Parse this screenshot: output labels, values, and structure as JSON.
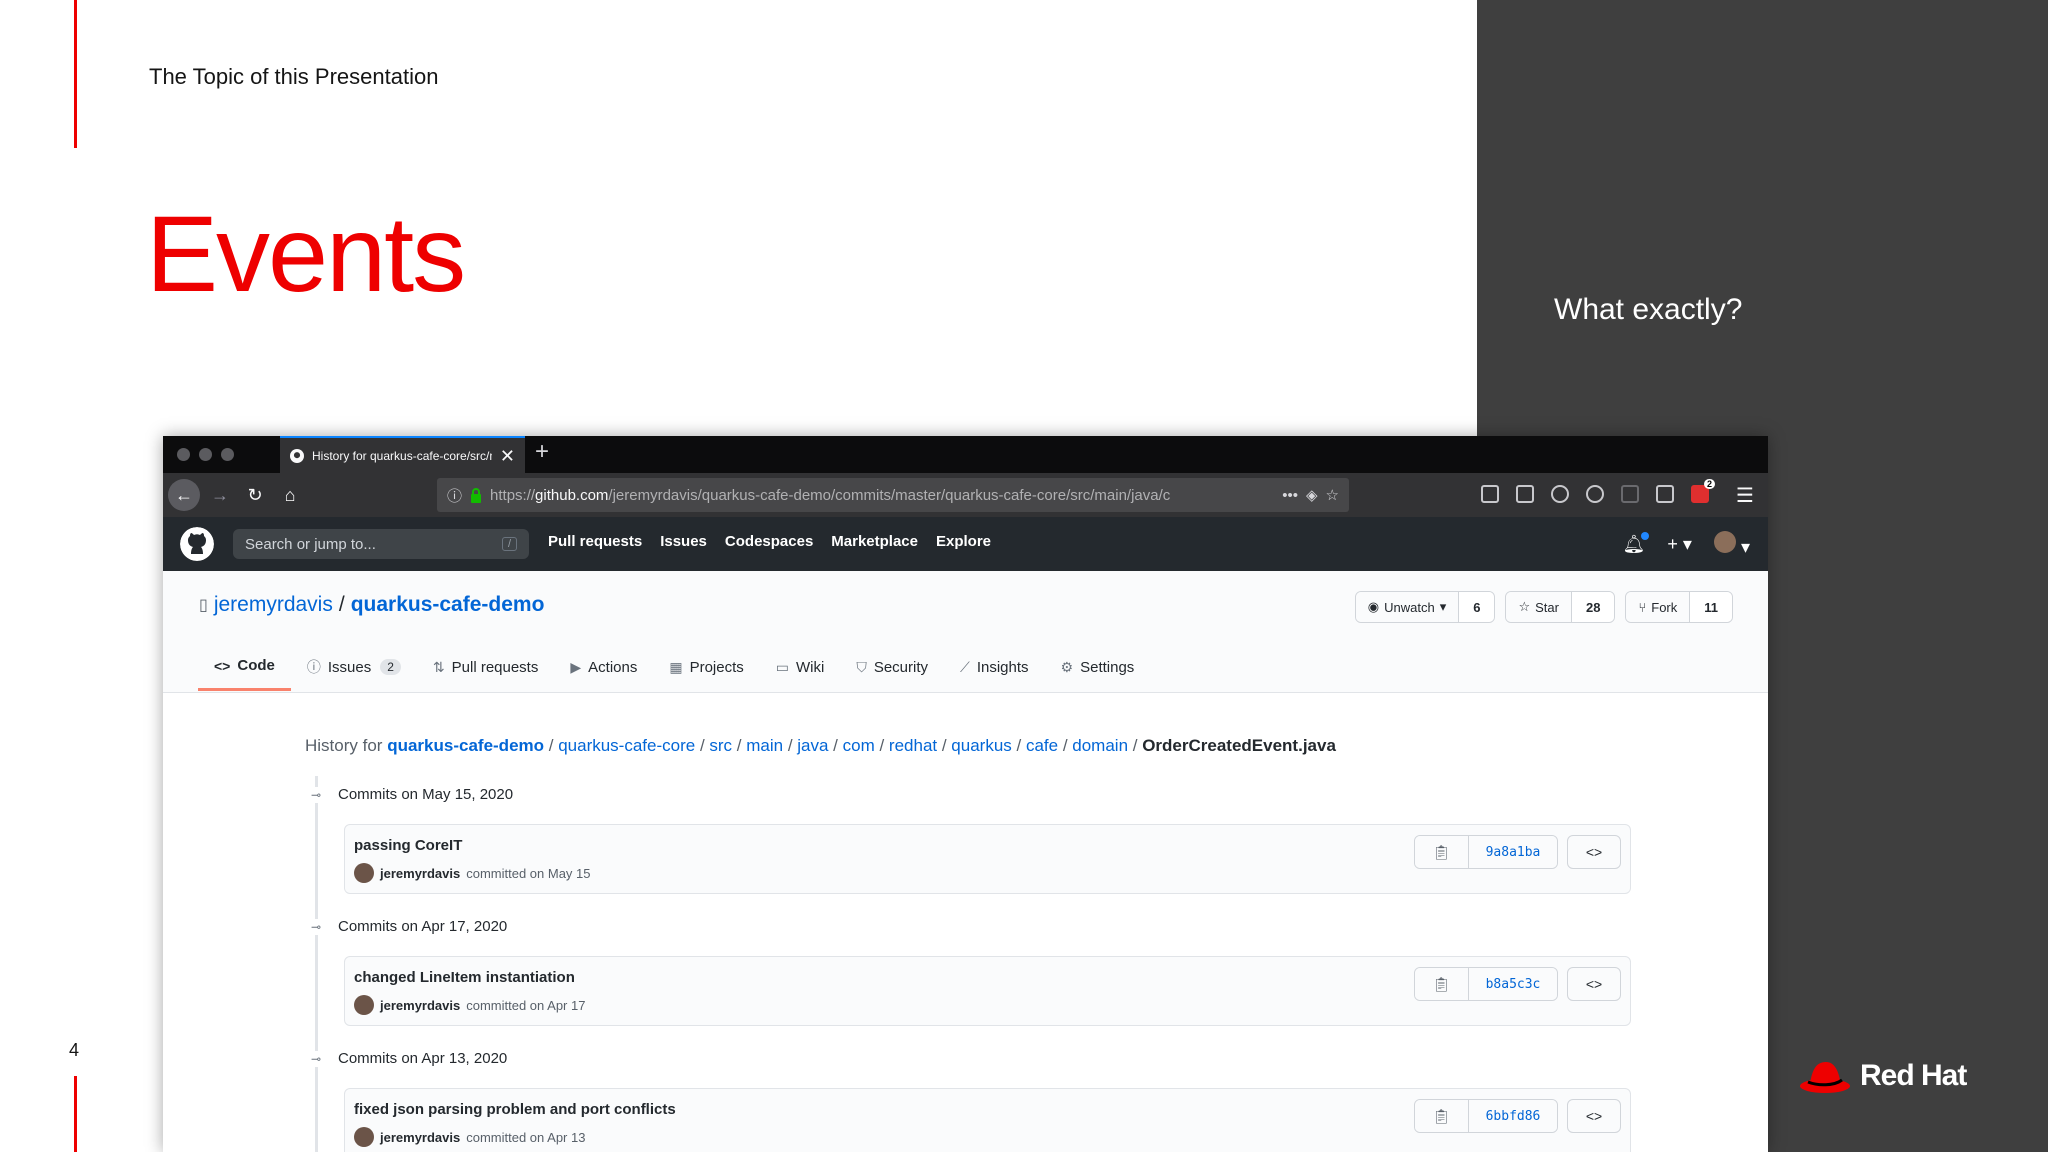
{
  "slide": {
    "topic": "The Topic of this Presentation",
    "title": "Events",
    "side_question": "What exactly?",
    "page_number": "4",
    "brand": "Red Hat",
    "accent_color": "#ee0000",
    "side_bg": "#3f3f3f"
  },
  "browser": {
    "tab_title": "History for quarkus-cafe-core/src/main/java",
    "tab_close": "✕",
    "new_tab": "+",
    "url_scheme": "https://",
    "url_host": "github.com",
    "url_path": "/jeremyrdavis/quarkus-cafe-demo/commits/master/quarkus-cafe-core/src/main/java/c",
    "url_more": "•••",
    "toolbar_badge": "2"
  },
  "github": {
    "search_placeholder": "Search or jump to...",
    "search_shortcut": "/",
    "nav": [
      "Pull requests",
      "Issues",
      "Codespaces",
      "Marketplace",
      "Explore"
    ],
    "repo_owner": "jeremyrdavis",
    "repo_sep": "/",
    "repo_name": "quarkus-cafe-demo",
    "unwatch_label": "Unwatch",
    "unwatch_count": "6",
    "star_label": "Star",
    "star_count": "28",
    "fork_label": "Fork",
    "fork_count": "11",
    "tabs": {
      "code": "Code",
      "issues": "Issues",
      "issues_count": "2",
      "pulls": "Pull requests",
      "actions": "Actions",
      "projects": "Projects",
      "wiki": "Wiki",
      "security": "Security",
      "insights": "Insights",
      "settings": "Settings"
    },
    "history": {
      "prefix": "History for",
      "path": [
        "quarkus-cafe-demo",
        "quarkus-cafe-core",
        "src",
        "main",
        "java",
        "com",
        "redhat",
        "quarkus",
        "cafe",
        "domain"
      ],
      "file": "OrderCreatedEvent.java"
    },
    "commit_groups": [
      {
        "date": "Commits on May 15, 2020",
        "message": "passing CoreIT",
        "author": "jeremyrdavis",
        "committed": "committed on May 15",
        "sha": "9a8a1ba"
      },
      {
        "date": "Commits on Apr 17, 2020",
        "message": "changed LineItem instantiation",
        "author": "jeremyrdavis",
        "committed": "committed on Apr 17",
        "sha": "b8a5c3c"
      },
      {
        "date": "Commits on Apr 13, 2020",
        "message": "fixed json parsing problem and port conflicts",
        "author": "jeremyrdavis",
        "committed": "committed on Apr 13",
        "sha": "6bbfd86"
      }
    ]
  }
}
